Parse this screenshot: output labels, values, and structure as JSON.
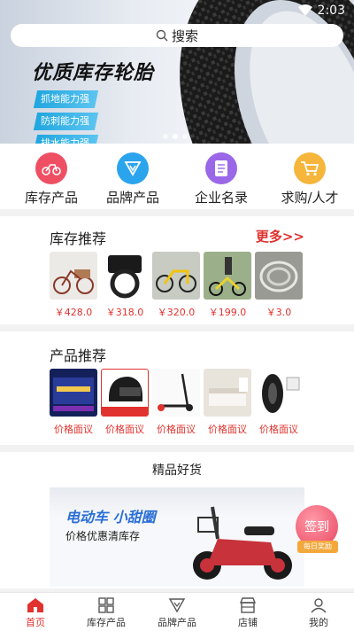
{
  "status_bar": {
    "time": "2:03",
    "icons": [
      "wifi-icon",
      "cellular-icon",
      "battery-icon"
    ]
  },
  "search": {
    "placeholder": "搜索",
    "icon": "search-icon"
  },
  "banner": {
    "title": "优质库存轮胎",
    "chips": [
      "抓地能力强",
      "防刺能力强",
      "排水能力强"
    ],
    "slide_count": 3,
    "active_slide": 1
  },
  "categories": [
    {
      "label": "库存产品",
      "icon": "motorcycle-icon",
      "color": "#ef4f63"
    },
    {
      "label": "品牌产品",
      "icon": "brand-badge-icon",
      "color": "#2ba4ee"
    },
    {
      "label": "企业名录",
      "icon": "document-icon",
      "color": "#9a67e8"
    },
    {
      "label": "求购/人才",
      "icon": "shopping-cart-icon",
      "color": "#f6b63b"
    }
  ],
  "stock": {
    "title": "库存推荐",
    "more": "更多>>",
    "items": [
      {
        "price": "￥428.0",
        "image": "tricycle"
      },
      {
        "price": "￥318.0",
        "image": "bike-lock"
      },
      {
        "price": "￥320.0",
        "image": "yellow-bike"
      },
      {
        "price": "￥199.0",
        "image": "balance-bike"
      },
      {
        "price": "￥3.0",
        "image": "cables"
      }
    ]
  },
  "products": {
    "title": "产品推荐",
    "items": [
      {
        "label": "价格面议",
        "image": "promo-board"
      },
      {
        "label": "价格面议",
        "image": "helmet"
      },
      {
        "label": "价格面议",
        "image": "scooter"
      },
      {
        "label": "价格面议",
        "image": "bedroom"
      },
      {
        "label": "价格面议",
        "image": "tire"
      }
    ]
  },
  "featured": {
    "title": "精品好货",
    "promo_title": "电动车  小甜圈",
    "promo_subtitle": "价格优惠清库存",
    "checkin_label": "签到",
    "checkin_sub": "每日奖励"
  },
  "tabbar": {
    "items": [
      {
        "label": "首页",
        "icon": "home-icon",
        "active": true
      },
      {
        "label": "库存产品",
        "icon": "grid-icon",
        "active": false
      },
      {
        "label": "品牌产品",
        "icon": "brand-icon",
        "active": false
      },
      {
        "label": "店铺",
        "icon": "store-icon",
        "active": false
      },
      {
        "label": "我的",
        "icon": "user-icon",
        "active": false
      }
    ]
  },
  "colors": {
    "accent": "#e0322e",
    "promo_blue": "#2a6fd6"
  }
}
